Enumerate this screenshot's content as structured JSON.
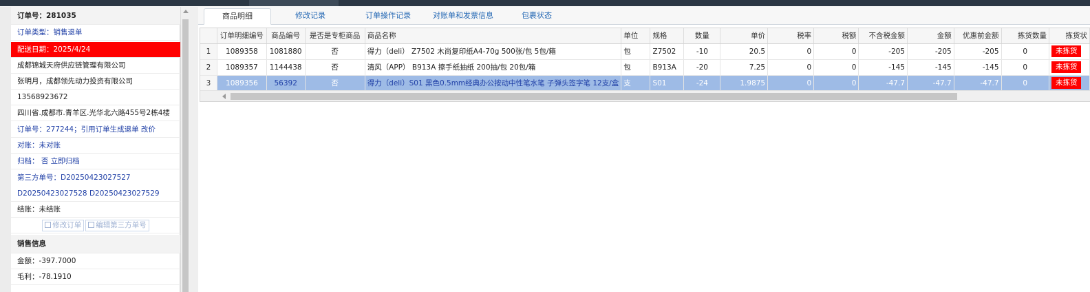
{
  "order": {
    "title": "订单号：281035",
    "type": "订单类型：销售退单",
    "delivery_date": "配送日期：2025/4/24",
    "company": "成都锦城天府供应链管理有限公司",
    "contact": "张明月，成都领先动力投资有限公司",
    "phone": "13568923672",
    "address": "四川省.成都市.青羊区.光华北六路455号2栋4楼",
    "ref_order": "订单号：277244；引用订单生成退单 改价",
    "reconcile": "对账：未对账",
    "archive": "归档： 否 立即归档",
    "third_party_1": "第三方单号：D20250423027527",
    "third_party_2": "D20250423027528 D20250423027529",
    "settlement": "结账：未结账",
    "btn_edit_order": "修改订单",
    "btn_edit_third": "编辑第三方单号"
  },
  "sales": {
    "header": "销售信息",
    "amount": "金额：-397.7000",
    "profit": "毛利：-78.1910"
  },
  "tabs": [
    {
      "label": "商品明细"
    },
    {
      "label": "修改记录"
    },
    {
      "label": "订单操作记录"
    },
    {
      "label": "对账单和发票信息"
    },
    {
      "label": "包裹状态"
    }
  ],
  "table": {
    "columns": [
      "订单明细编号",
      "商品编号",
      "是否是专柜商品",
      "商品名称",
      "单位",
      "规格",
      "数量",
      "单价",
      "税率",
      "税额",
      "不含税金额",
      "金额",
      "优惠前金额",
      "拣货数量",
      "拣货状"
    ],
    "rows": [
      {
        "n": "1",
        "detail_id": "1089358",
        "product_id": "1081880",
        "counter": "否",
        "name": "得力（deli） Z7502 木尚复印纸A4-70g 500张/包 5包/箱",
        "unit": "包",
        "spec": "Z7502",
        "qty": "-10",
        "price": "20.5",
        "tax_rate": "0",
        "tax": "0",
        "net": "-205",
        "amount": "-205",
        "pre": "-205",
        "pick_qty": "0",
        "pick_status": "未拣货"
      },
      {
        "n": "2",
        "detail_id": "1089357",
        "product_id": "1144438",
        "counter": "否",
        "name": "清风（APP） B913A 擦手纸抽纸 200抽/包 20包/箱",
        "unit": "包",
        "spec": "B913A",
        "qty": "-20",
        "price": "7.25",
        "tax_rate": "0",
        "tax": "0",
        "net": "-145",
        "amount": "-145",
        "pre": "-145",
        "pick_qty": "0",
        "pick_status": "未拣货"
      },
      {
        "n": "3",
        "detail_id": "1089356",
        "product_id": "56392",
        "counter": "否",
        "name": "得力（deli）S01 黑色0.5mm经典办公按动中性笔水笔 子弹头签字笔 12支/盒",
        "unit": "支",
        "spec": "S01",
        "qty": "-24",
        "price": "1.9875",
        "tax_rate": "0",
        "tax": "0",
        "net": "-47.7",
        "amount": "-47.7",
        "pre": "-47.7",
        "pick_qty": "0",
        "pick_status": "未拣货"
      }
    ]
  },
  "colors": {
    "accent": "#1f3fa6",
    "selected_row": "#9ebbe6",
    "alert": "#ff0000"
  }
}
